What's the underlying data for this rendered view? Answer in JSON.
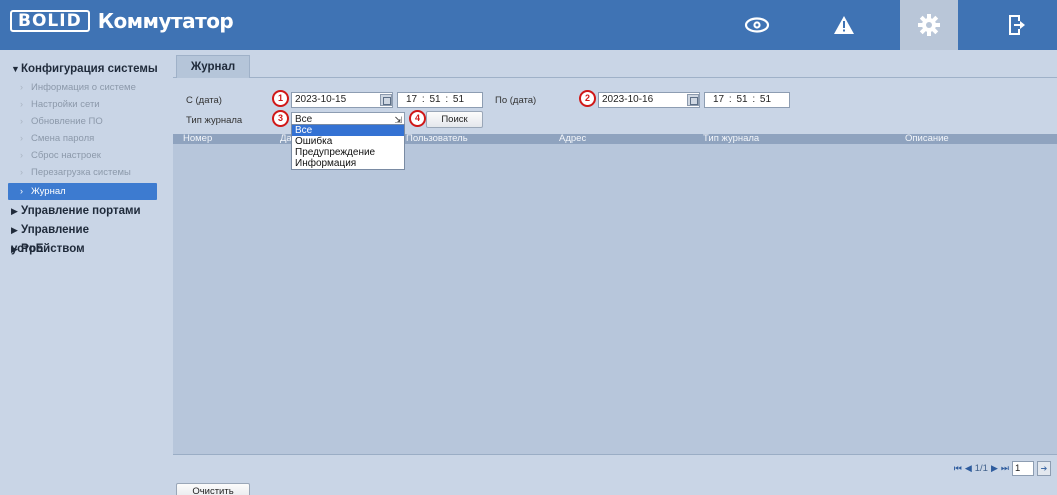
{
  "header": {
    "logo_box": "BOLID",
    "logo_text": "Коммутатор"
  },
  "sidebar": {
    "config_section": "Конфигурация системы",
    "items": [
      {
        "label": "Информация о системе"
      },
      {
        "label": "Настройки сети"
      },
      {
        "label": "Обновление ПО"
      },
      {
        "label": "Смена пароля"
      },
      {
        "label": "Сброс настроек"
      },
      {
        "label": "Перезагрузка системы"
      },
      {
        "label": "Журнал"
      }
    ],
    "other_sections": [
      {
        "label": "Управление портами"
      },
      {
        "label": "Управление устройством"
      },
      {
        "label": "PoE"
      }
    ]
  },
  "tab": {
    "label": "Журнал"
  },
  "form": {
    "from_label": "С (дата)",
    "from_date": "2023-10-15",
    "from_time": "17 :  51 :  51",
    "to_label": "По (дата)",
    "to_date": "2023-10-16",
    "to_time": "17 :  51 :  51",
    "type_label": "Тип журнала",
    "type_value": "Все",
    "search_label": "Поиск",
    "badges": [
      "1",
      "2",
      "3",
      "4"
    ]
  },
  "dropdown": {
    "options": [
      "Все",
      "Ошибка",
      "Предупреждение",
      "Информация"
    ]
  },
  "table": {
    "columns": [
      "Номер",
      "Дата",
      "Пользователь",
      "Адрес",
      "Тип журнала",
      "Описание"
    ]
  },
  "pager": {
    "info": "1/1",
    "page": "1"
  },
  "clear_label": "Очистить",
  "colors": {
    "header": "#3f73b4",
    "active_item": "#3d7bd0",
    "badge": "#d01818"
  }
}
